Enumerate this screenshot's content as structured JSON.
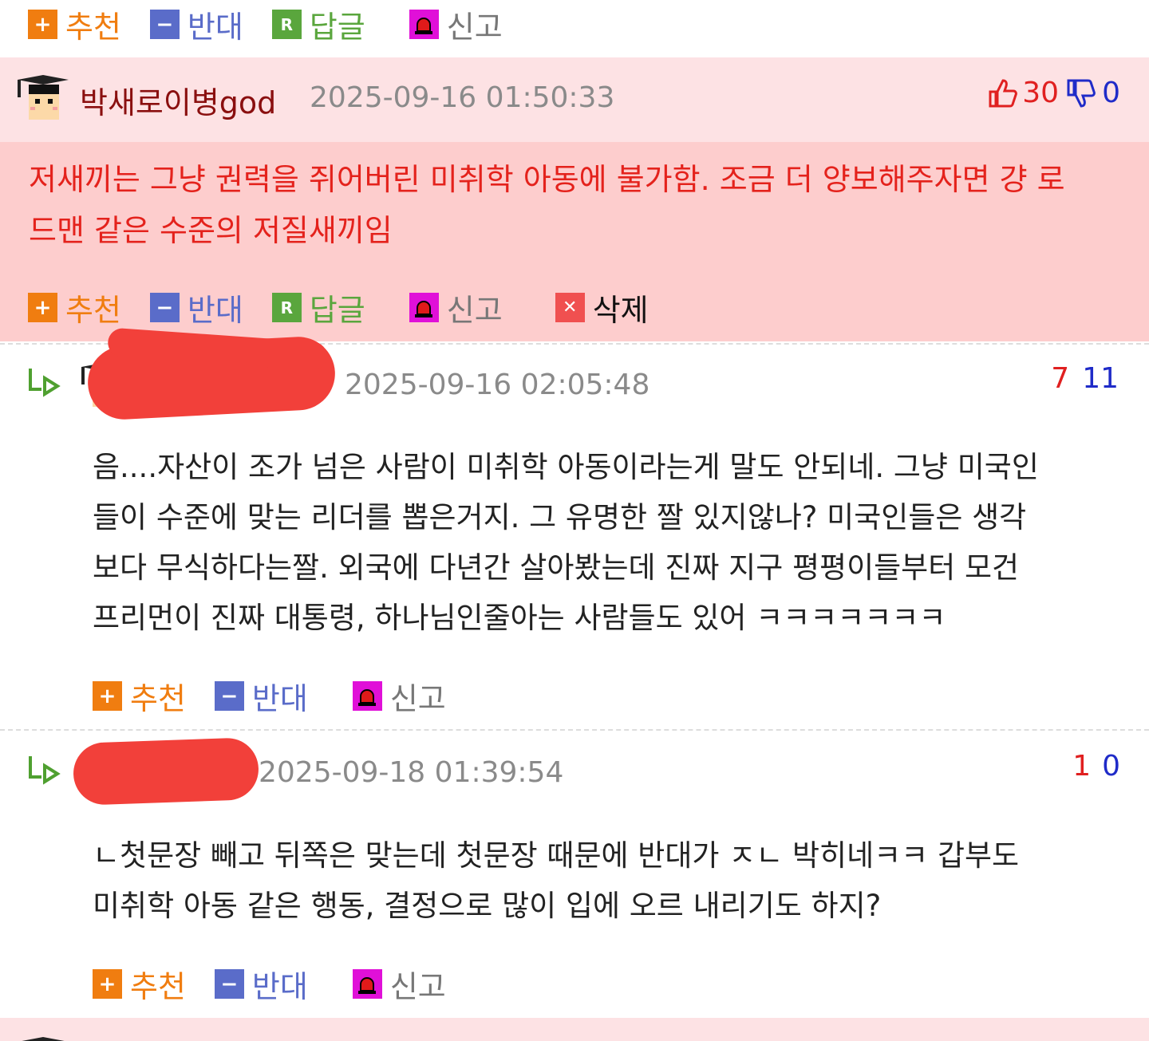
{
  "actions": {
    "recommend": "추천",
    "oppose": "반대",
    "reply": "답글",
    "report": "신고",
    "delete": "삭제"
  },
  "comment_main": {
    "author": "박새로이병god",
    "date": "2025-09-16 01:50:33",
    "up": "30",
    "down": "0",
    "text_line1": "저새끼는 그냥 권력을 쥐어버린 미취학 아동에 불가함. 조금 더 양보해주자면 걍 로",
    "text_line2": "드맨 같은 수준의 저질새끼임"
  },
  "reply1": {
    "date": "2025-09-16 02:05:48",
    "up": "7",
    "down": "11",
    "lines": [
      "음....자산이 조가 넘은 사람이 미취학 아동이라는게 말도 안되네. 그냥 미국인",
      "들이 수준에 맞는 리더를 뽑은거지. 그 유명한 짤 있지않나? 미국인들은 생각",
      "보다 무식하다는짤. 외국에 다년간 살아봤는데 진짜 지구 평평이들부터 모건",
      "프리먼이 진짜 대통령, 하나님인줄아는 사람들도 있어 ㅋㅋㅋㅋㅋㅋㅋ"
    ]
  },
  "reply2": {
    "date": "2025-09-18 01:39:54",
    "up": "1",
    "down": "0",
    "lines": [
      "ㄴ첫문장 빼고 뒤쪽은 맞는데 첫문장 때문에 반대가 ㅈㄴ 박히네ㅋㅋ 갑부도",
      "미취학 아동 같은 행동, 결정으로 많이 입에 오르 내리기도 하지?"
    ]
  },
  "colors": {
    "highlight_header": "#fde2e4",
    "highlight_body": "#fdcdcd",
    "vote_up": "#e02020",
    "vote_down": "#1f2bc8"
  }
}
